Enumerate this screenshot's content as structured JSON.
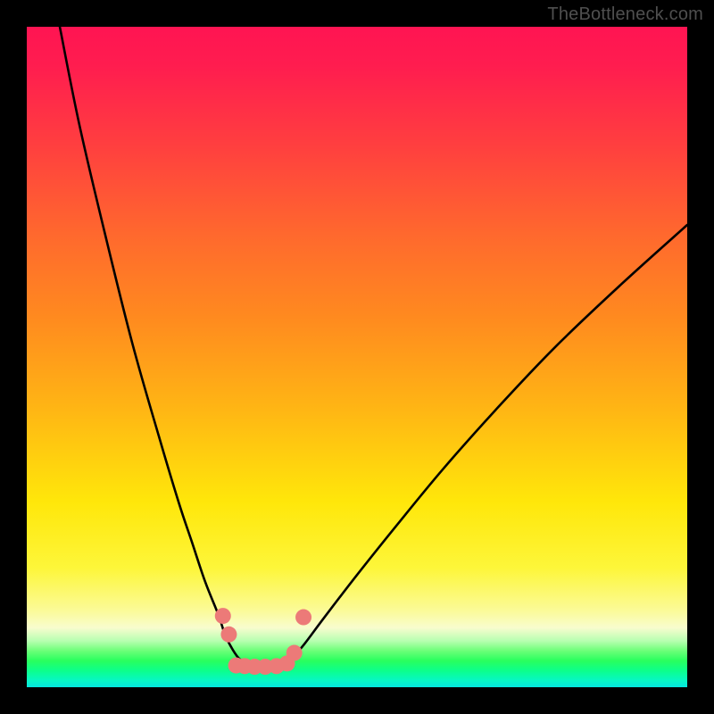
{
  "watermark": "TheBottleneck.com",
  "chart_data": {
    "type": "line",
    "title": "",
    "xlabel": "",
    "ylabel": "",
    "xlim": [
      0,
      100
    ],
    "ylim": [
      0,
      100
    ],
    "grid": false,
    "legend": false,
    "note": "Axes unlabeled in source image; a V-shaped black curve drops from top toward a minimum near x≈34 and rises to mid-right. Lower colored bands (green/cyan) indicate low bottleneck; top red indicates high.",
    "series": [
      {
        "name": "bottleneck-curve-left",
        "x": [
          5,
          8,
          12,
          16,
          20,
          23,
          25,
          27,
          29,
          30,
          31,
          32,
          33
        ],
        "values": [
          100,
          85,
          68,
          52,
          38,
          28,
          22,
          16,
          11,
          8,
          6,
          4.5,
          3.6
        ]
      },
      {
        "name": "bottleneck-curve-right",
        "x": [
          40,
          42,
          45,
          50,
          56,
          63,
          71,
          80,
          90,
          100
        ],
        "values": [
          4.2,
          6.5,
          10.5,
          17,
          24.5,
          33,
          42,
          51.5,
          61,
          70
        ]
      }
    ],
    "floor_segment": {
      "x_start": 33,
      "x_end": 40,
      "y": 3.2
    },
    "markers": [
      {
        "x": 29.7,
        "y": 10.8
      },
      {
        "x": 30.6,
        "y": 8.0
      },
      {
        "x": 31.7,
        "y": 3.3
      },
      {
        "x": 33.0,
        "y": 3.2
      },
      {
        "x": 34.5,
        "y": 3.1
      },
      {
        "x": 36.1,
        "y": 3.1
      },
      {
        "x": 37.8,
        "y": 3.2
      },
      {
        "x": 39.4,
        "y": 3.6
      },
      {
        "x": 40.5,
        "y": 5.2
      },
      {
        "x": 41.9,
        "y": 10.6
      }
    ],
    "marker_style": {
      "color": "#ec7a78",
      "radius_px": 9
    },
    "gradient_stops_pct_from_top": [
      {
        "pct": 0,
        "color": "#ff1452"
      },
      {
        "pct": 18,
        "color": "#ff3f3f"
      },
      {
        "pct": 44,
        "color": "#ff8a1f"
      },
      {
        "pct": 72,
        "color": "#ffe70a"
      },
      {
        "pct": 88,
        "color": "#fbfb9a"
      },
      {
        "pct": 94,
        "color": "#6bff78"
      },
      {
        "pct": 100,
        "color": "#05e6df"
      }
    ]
  }
}
